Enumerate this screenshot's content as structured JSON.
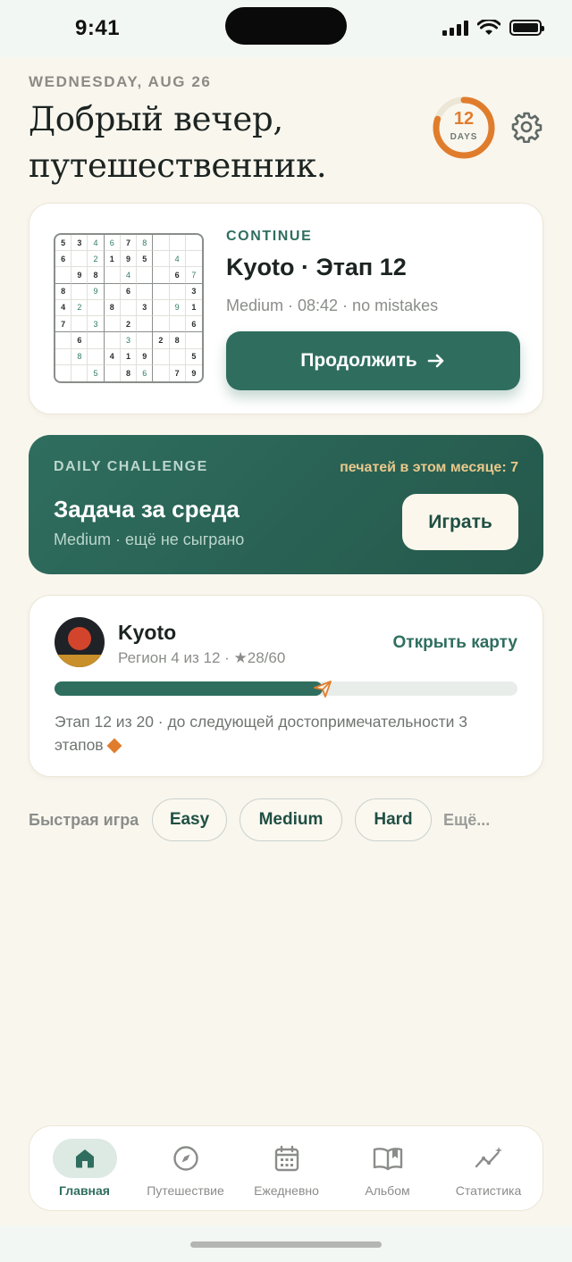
{
  "status_bar": {
    "time": "9:41"
  },
  "header": {
    "date": "WEDNESDAY, AUG 26",
    "greeting_line1": "Добрый вечер,",
    "greeting_line2": "путешественник.",
    "streak": {
      "number": "12",
      "label": "DAYS",
      "progress": 0.8,
      "color": "#e07d2c"
    },
    "settings_icon": "gear-icon"
  },
  "continue_card": {
    "kicker": "CONTINUE",
    "title": "Kyoto · Этап 12",
    "meta": "Medium · 08:42 · no mistakes",
    "button_label": "Продолжить",
    "button_icon": "arrow-right-icon",
    "grid": [
      [
        "5",
        "3",
        "4",
        "6",
        "7",
        "8",
        "",
        "",
        ""
      ],
      [
        "6",
        "",
        "2",
        "1",
        "9",
        "5",
        "",
        "4",
        ""
      ],
      [
        "",
        "9",
        "8",
        "",
        "4",
        "",
        "",
        "6",
        "7"
      ],
      [
        "8",
        "",
        "9",
        "",
        "6",
        "",
        "",
        "",
        "3"
      ],
      [
        "4",
        "2",
        "",
        "8",
        "",
        "3",
        "",
        "9",
        "1"
      ],
      [
        "7",
        "",
        "3",
        "",
        "2",
        "",
        "",
        "",
        "6"
      ],
      [
        "",
        "6",
        "",
        "",
        "3",
        "",
        "2",
        "8",
        ""
      ],
      [
        "",
        "8",
        "",
        "4",
        "1",
        "9",
        "",
        "",
        "5"
      ],
      [
        "",
        "",
        "5",
        "",
        "8",
        "6",
        "",
        "7",
        "9"
      ]
    ],
    "user_cells": [
      [
        0,
        2
      ],
      [
        0,
        3
      ],
      [
        0,
        5
      ],
      [
        1,
        2
      ],
      [
        1,
        7
      ],
      [
        2,
        4
      ],
      [
        2,
        8
      ],
      [
        3,
        2
      ],
      [
        4,
        1
      ],
      [
        4,
        7
      ],
      [
        5,
        2
      ],
      [
        6,
        4
      ],
      [
        7,
        1
      ],
      [
        8,
        2
      ],
      [
        8,
        5
      ]
    ]
  },
  "daily_challenge": {
    "kicker": "DAILY CHALLENGE",
    "stamps": "печатей в этом месяце: 7",
    "title": "Задача за среда",
    "meta": "Medium · ещё не сыграно",
    "button_label": "Играть"
  },
  "journey": {
    "region_name": "Kyoto",
    "region_meta": "Регион 4 из 12 · ★28/60",
    "open_map": "Открыть карту",
    "progress": 0.58,
    "progress_icon": "paper-plane-icon",
    "note": "Этап 12 из 20 · до следующей достопримечательности 3 этапов",
    "landmark_icon": "diamond-icon"
  },
  "quick_play": {
    "label": "Быстрая игра",
    "chips": [
      "Easy",
      "Medium",
      "Hard"
    ],
    "more": "Ещё..."
  },
  "tab_bar": {
    "items": [
      {
        "label": "Главная",
        "icon": "home-icon",
        "active": true
      },
      {
        "label": "Путешествие",
        "icon": "compass-icon",
        "active": false
      },
      {
        "label": "Ежедневно",
        "icon": "calendar-icon",
        "active": false
      },
      {
        "label": "Альбом",
        "icon": "book-icon",
        "active": false
      },
      {
        "label": "Статистика",
        "icon": "stats-icon",
        "active": false
      }
    ]
  },
  "colors": {
    "accent": "#2f6e5f",
    "orange": "#e07d2c",
    "background": "#f9f6ee"
  }
}
